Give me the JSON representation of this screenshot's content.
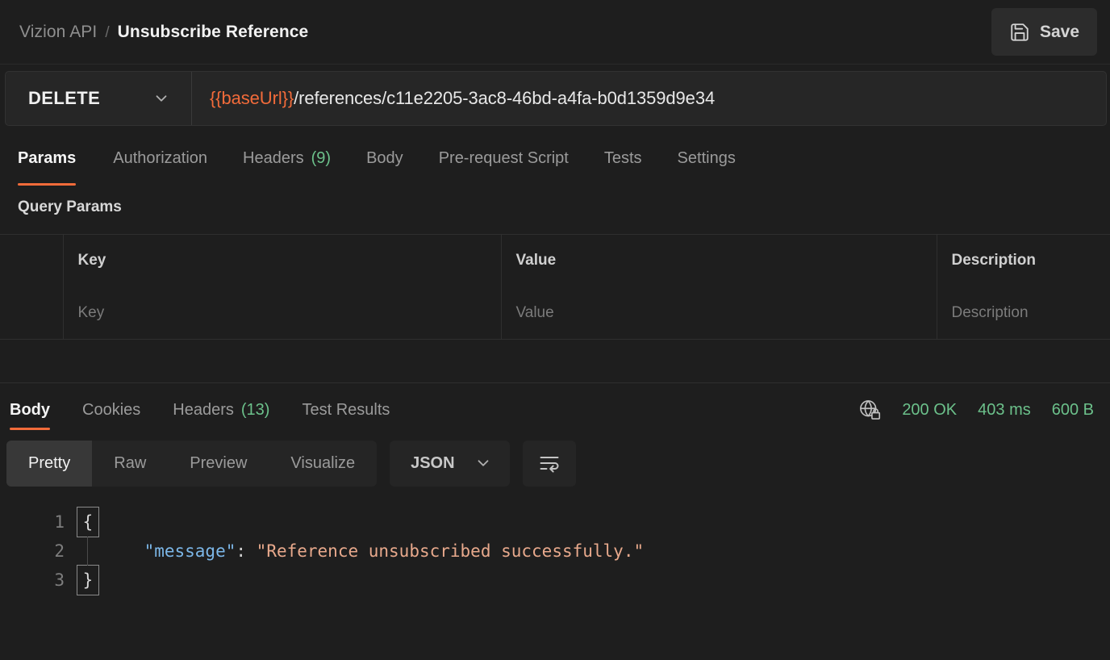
{
  "header": {
    "collection": "Vizion API",
    "separator": "/",
    "request_name": "Unsubscribe Reference",
    "save_label": "Save",
    "save_icon": "floppy-disk-icon"
  },
  "url_bar": {
    "method": "DELETE",
    "method_chevron_icon": "chevron-down-icon",
    "url_variable": "{{baseUrl}}",
    "url_path": "/references/c11e2205-3ac8-46bd-a4fa-b0d1359d9e34",
    "url_full": "{{baseUrl}}/references/c11e2205-3ac8-46bd-a4fa-b0d1359d9e34"
  },
  "request_tabs": [
    {
      "label": "Params",
      "count": "",
      "active": true
    },
    {
      "label": "Authorization",
      "count": "",
      "active": false
    },
    {
      "label": "Headers",
      "count": "(9)",
      "active": false
    },
    {
      "label": "Body",
      "count": "",
      "active": false
    },
    {
      "label": "Pre-request Script",
      "count": "",
      "active": false
    },
    {
      "label": "Tests",
      "count": "",
      "active": false
    },
    {
      "label": "Settings",
      "count": "",
      "active": false
    }
  ],
  "query_params": {
    "title": "Query Params",
    "columns": [
      "",
      "Key",
      "Value",
      "Description"
    ],
    "rows": [
      {
        "key_placeholder": "Key",
        "value_placeholder": "Value",
        "description_placeholder": "Description"
      }
    ]
  },
  "response_tabs": [
    {
      "label": "Body",
      "count": "",
      "active": true
    },
    {
      "label": "Cookies",
      "count": "",
      "active": false
    },
    {
      "label": "Headers",
      "count": "(13)",
      "active": false
    },
    {
      "label": "Test Results",
      "count": "",
      "active": false
    }
  ],
  "response_meta": {
    "security_icon": "globe-lock-icon",
    "status": "200 OK",
    "time": "403 ms",
    "size": "600 B"
  },
  "format_bar": {
    "views": [
      {
        "label": "Pretty",
        "active": true
      },
      {
        "label": "Raw",
        "active": false
      },
      {
        "label": "Preview",
        "active": false
      },
      {
        "label": "Visualize",
        "active": false
      }
    ],
    "language": "JSON",
    "language_chevron_icon": "chevron-down-icon",
    "wrap_icon": "word-wrap-icon"
  },
  "response_body": {
    "lines": [
      {
        "no": "1",
        "brace": "{",
        "boxed": true,
        "content": ""
      },
      {
        "no": "2",
        "brace": "",
        "boxed": false,
        "content": "message"
      },
      {
        "no": "3",
        "brace": "}",
        "boxed": true,
        "content": ""
      }
    ],
    "key": "\"message\"",
    "colon": ": ",
    "value": "\"Reference unsubscribed successfully.\"",
    "indent": "    "
  },
  "colors": {
    "accent": "#f26b3a",
    "status_green": "#6cc18b",
    "json_key": "#7cb7e8",
    "json_string": "#e8a98c",
    "background": "#1e1e1e"
  }
}
